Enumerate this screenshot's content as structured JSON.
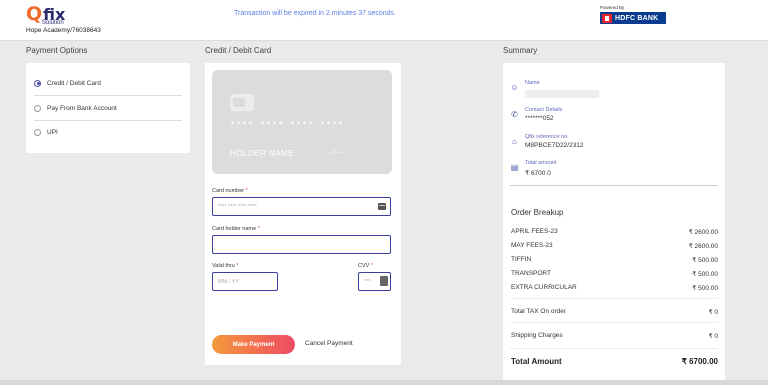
{
  "header": {
    "logo_q": "Q",
    "logo_fix": "fix",
    "logo_sub": "Solution",
    "merchant": "Hope Academy/76038643",
    "expiry_message": "Transaction will be expired in 2 minutes 37 seconds.",
    "powered_by": "Powered By",
    "bank_name": "HDFC BANK"
  },
  "sections": {
    "payment_options": "Payment Options",
    "card": "Credit / Debit Card",
    "summary": "Summary"
  },
  "payment_options": [
    {
      "label": "Credit / Debit Card",
      "selected": true
    },
    {
      "label": "Pay From Bank Account",
      "selected": false
    },
    {
      "label": "UPI",
      "selected": false
    }
  ],
  "card_preview": {
    "number": "**** **** **** ****",
    "holder": "HOLDER NAME",
    "expiry": "--/--"
  },
  "form": {
    "card_number_label": "Card number",
    "card_number_placeholder": "**** **** **** ****",
    "holder_label": "Card holder name",
    "holder_placeholder": "",
    "valid_label": "Valid thru",
    "valid_placeholder": "MM / YY",
    "cvv_label": "CVV",
    "cvv_placeholder": "***",
    "required_mark": "*",
    "pay_button": "Make Payment",
    "cancel_button": "Cancel Payment"
  },
  "summary": {
    "name_label": "Name",
    "name_value": "",
    "contact_label": "Contact Details",
    "contact_value": "*******052",
    "ref_label": "Qfix reference no.",
    "ref_value": "M8PBCE7D22/2312",
    "total_label": "Total amount",
    "total_value": "₹ 6700.0",
    "order_breakup_title": "Order Breakup",
    "items": [
      {
        "label": "APRIL FEES-23",
        "amount": "₹ 2600.00"
      },
      {
        "label": "MAY FEES-23",
        "amount": "₹ 2600.00"
      },
      {
        "label": "TIFFIN",
        "amount": "₹ 500.00"
      },
      {
        "label": "TRANSPORT",
        "amount": "₹ 500.00"
      },
      {
        "label": "EXTRA CURRICULAR",
        "amount": "₹ 500.00"
      }
    ],
    "tax_label": "Total TAX On order",
    "tax_value": "₹ 0",
    "shipping_label": "Shipping Charges",
    "shipping_value": "₹ 0",
    "grand_total_label": "Total Amount",
    "grand_total_value": "₹ 6700.00"
  },
  "icons": {
    "name": "user-circle-icon",
    "contact": "phone-icon",
    "reference": "bank-icon",
    "total": "receipt-icon"
  },
  "colors": {
    "accent": "#4a50a8",
    "brand_orange": "#f26a2a",
    "expiry_text": "#5e7ce2",
    "pay_gradient_start": "#f59a3b",
    "pay_gradient_end": "#ee4a63",
    "bank_blue": "#0a3d8f"
  }
}
